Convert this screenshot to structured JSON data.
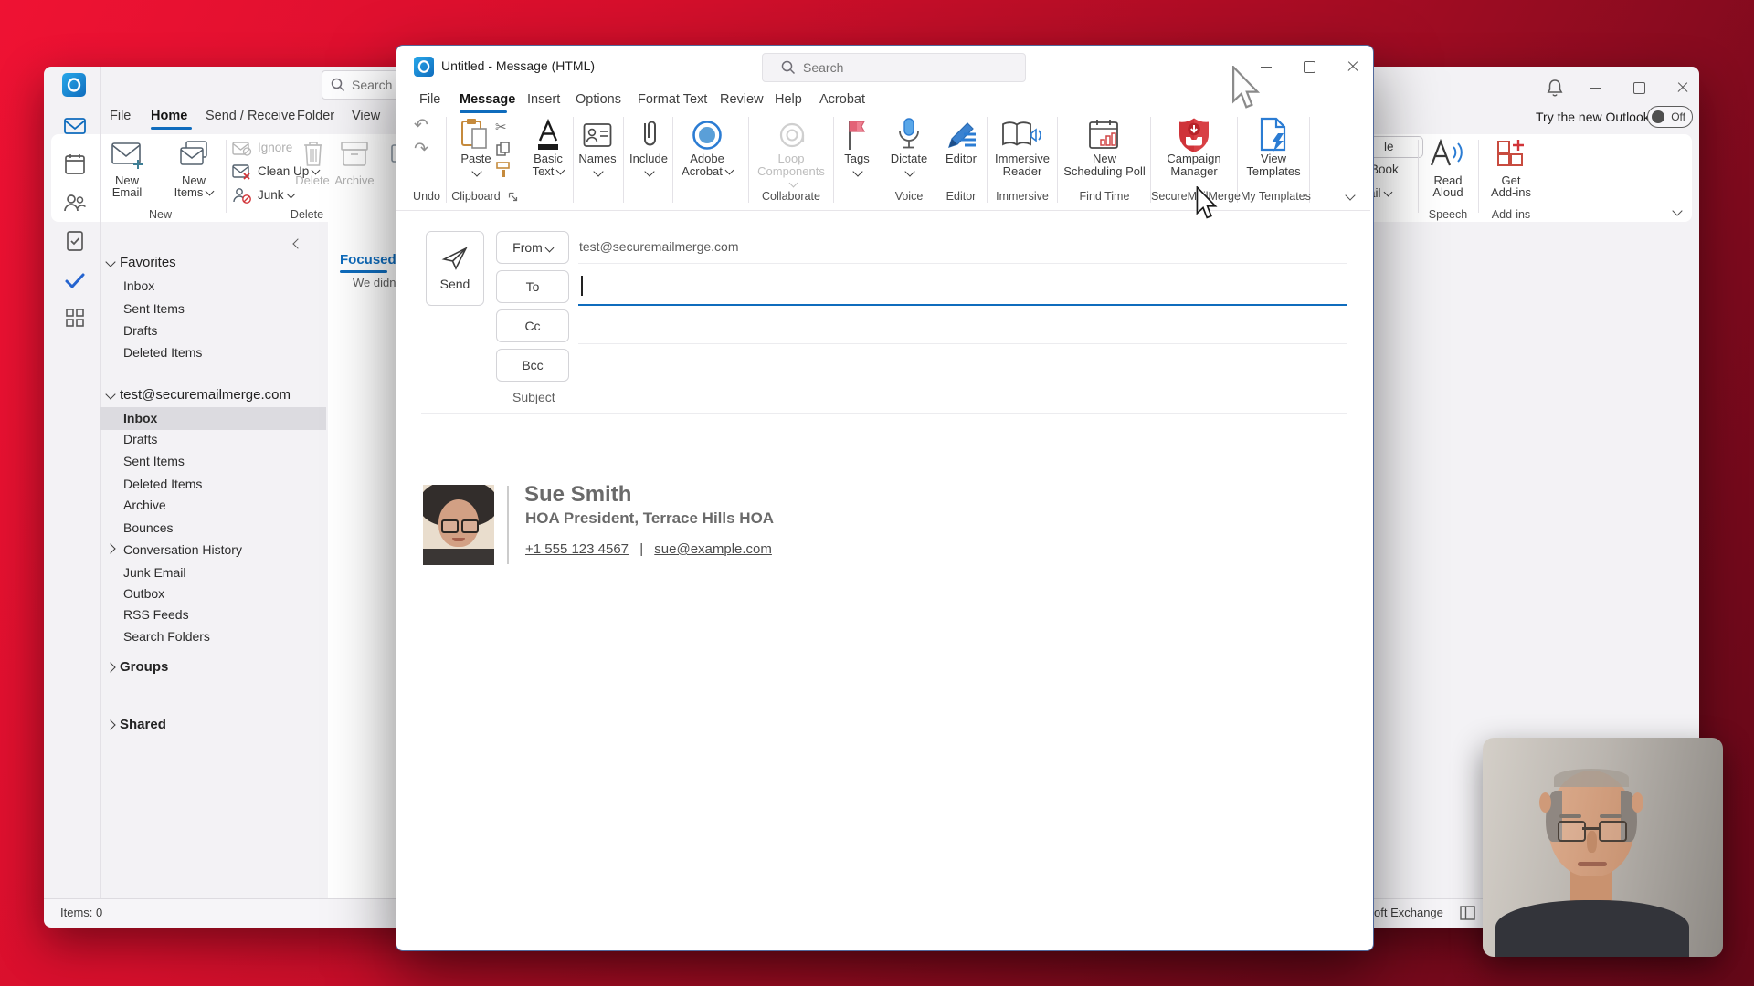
{
  "main_window": {
    "search_placeholder": "Search",
    "tabs": {
      "file": "File",
      "home": "Home",
      "send_receive": "Send / Receive",
      "folder": "Folder",
      "view": "View"
    },
    "try_new_outlook": "Try the new Outlook",
    "toggle_state": "Off",
    "ribbon": {
      "new_email_l1": "New",
      "new_email_l2": "Email",
      "new_items_l1": "New",
      "new_items_l2": "Items",
      "ignore": "Ignore",
      "clean_up": "Clean Up",
      "junk": "Junk",
      "delete": "Delete",
      "archive": "Archive",
      "group_new": "New",
      "group_delete": "Delete",
      "search_people_fragment": "le",
      "address_book_fragment": "Book",
      "filter_email_fragment": "ail",
      "read_aloud_l1": "Read",
      "read_aloud_l2": "Aloud",
      "get_addins_l1": "Get",
      "get_addins_l2": "Add-ins",
      "group_speech": "Speech",
      "group_addins": "Add-ins"
    },
    "folder_pane": {
      "favorites_header": "Favorites",
      "fav_items": [
        "Inbox",
        "Sent Items",
        "Drafts",
        "Deleted Items"
      ],
      "account_header": "test@securemailmerge.com",
      "acct_items": [
        "Inbox",
        "Drafts",
        "Sent Items",
        "Deleted Items",
        "Archive",
        "Bounces",
        "Conversation History",
        "Junk Email",
        "Outbox",
        "RSS Feeds",
        "Search Folders"
      ],
      "groups_header": "Groups",
      "shared_header": "Shared"
    },
    "list_pane": {
      "focused_tab": "Focused",
      "empty_text_fragment": "We didn'"
    },
    "status_bar": {
      "items_count": "Items: 0",
      "exchange_fragment": "oft Exchange"
    }
  },
  "compose_window": {
    "title": "Untitled  -  Message (HTML)",
    "search_placeholder": "Search",
    "tabs": {
      "file": "File",
      "message": "Message",
      "insert": "Insert",
      "options": "Options",
      "format_text": "Format Text",
      "review": "Review",
      "help": "Help",
      "acrobat": "Acrobat"
    },
    "ribbon": {
      "paste": "Paste",
      "basic_text_l1": "Basic",
      "basic_text_l2": "Text",
      "names": "Names",
      "include": "Include",
      "adobe_l1": "Adobe",
      "adobe_l2": "Acrobat",
      "loop_l1": "Loop",
      "loop_l2": "Components",
      "tags": "Tags",
      "dictate": "Dictate",
      "editor": "Editor",
      "immersive_l1": "Immersive",
      "immersive_l2": "Reader",
      "poll_l1": "New",
      "poll_l2": "Scheduling Poll",
      "campaign_l1": "Campaign",
      "campaign_l2": "Manager",
      "templates_l1": "View",
      "templates_l2": "Templates",
      "group_undo": "Undo",
      "group_clipboard": "Clipboard",
      "group_collaborate": "Collaborate",
      "group_voice": "Voice",
      "group_editor": "Editor",
      "group_immersive": "Immersive",
      "group_find_time": "Find Time",
      "group_securemailmerge": "SecureMailMerge",
      "group_my_templates": "My Templates"
    },
    "envelope": {
      "send": "Send",
      "from_label": "From",
      "from_value": "test@securemailmerge.com",
      "to_label": "To",
      "cc_label": "Cc",
      "bcc_label": "Bcc",
      "subject_label": "Subject"
    },
    "signature": {
      "name": "Sue Smith",
      "role": "HOA President, Terrace Hills HOA",
      "phone": "+1 555 123 4567",
      "separator": "|",
      "email": "sue@example.com"
    }
  },
  "icons": {
    "undo": "↶",
    "redo": "↷",
    "scissors": "✂"
  },
  "colors": {
    "accent_blue": "#0f6cbd",
    "desktop_red": "#c8102e",
    "campaign_red": "#d0312d",
    "todo_blue": "#2564cf"
  }
}
